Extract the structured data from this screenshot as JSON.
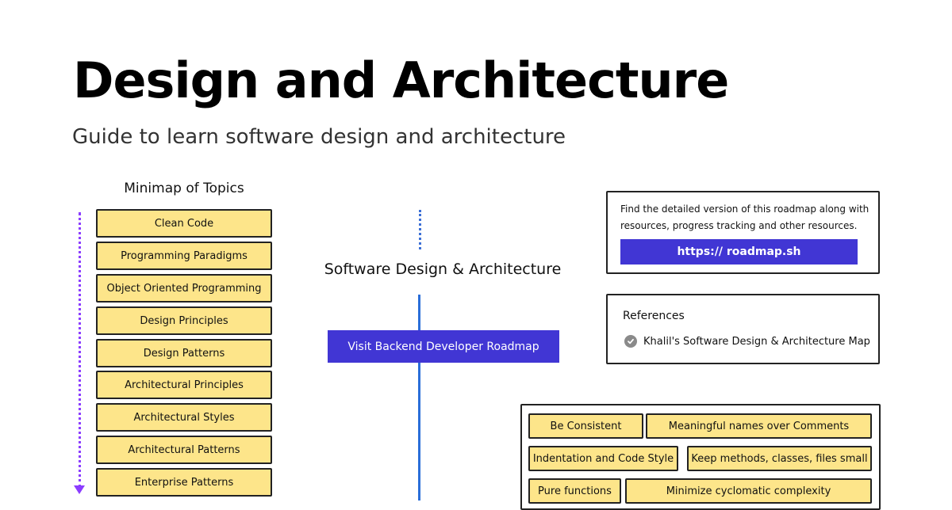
{
  "header": {
    "title": "Design and Architecture",
    "subtitle": "Guide to learn software design and architecture"
  },
  "minimap": {
    "title": "Minimap of Topics",
    "topics": [
      "Clean Code",
      "Programming Paradigms",
      "Object Oriented Programming",
      "Design Principles",
      "Design Patterns",
      "Architectural Principles",
      "Architectural Styles",
      "Architectural Patterns",
      "Enterprise Patterns"
    ]
  },
  "center": {
    "title": "Software Design & Architecture",
    "backend_button": "Visit Backend Developer Roadmap"
  },
  "info": {
    "text": "Find the detailed version of this roadmap along with resources, progress tracking and other resources.",
    "link_label": "https:// roadmap.sh"
  },
  "references": {
    "title": "References",
    "items": [
      "Khalil's Software Design & Architecture Map"
    ]
  },
  "practices": {
    "items": [
      "Be Consistent",
      "Meaningful names over Comments",
      "Indentation and Code Style",
      "Keep methods, classes, files small",
      "Pure functions",
      "Minimize cyclomatic complexity"
    ]
  },
  "colors": {
    "accent": "#4136d4",
    "node_fill": "#fde58a",
    "minimap_line": "#8b3dff",
    "connector": "#2a6ed9"
  }
}
